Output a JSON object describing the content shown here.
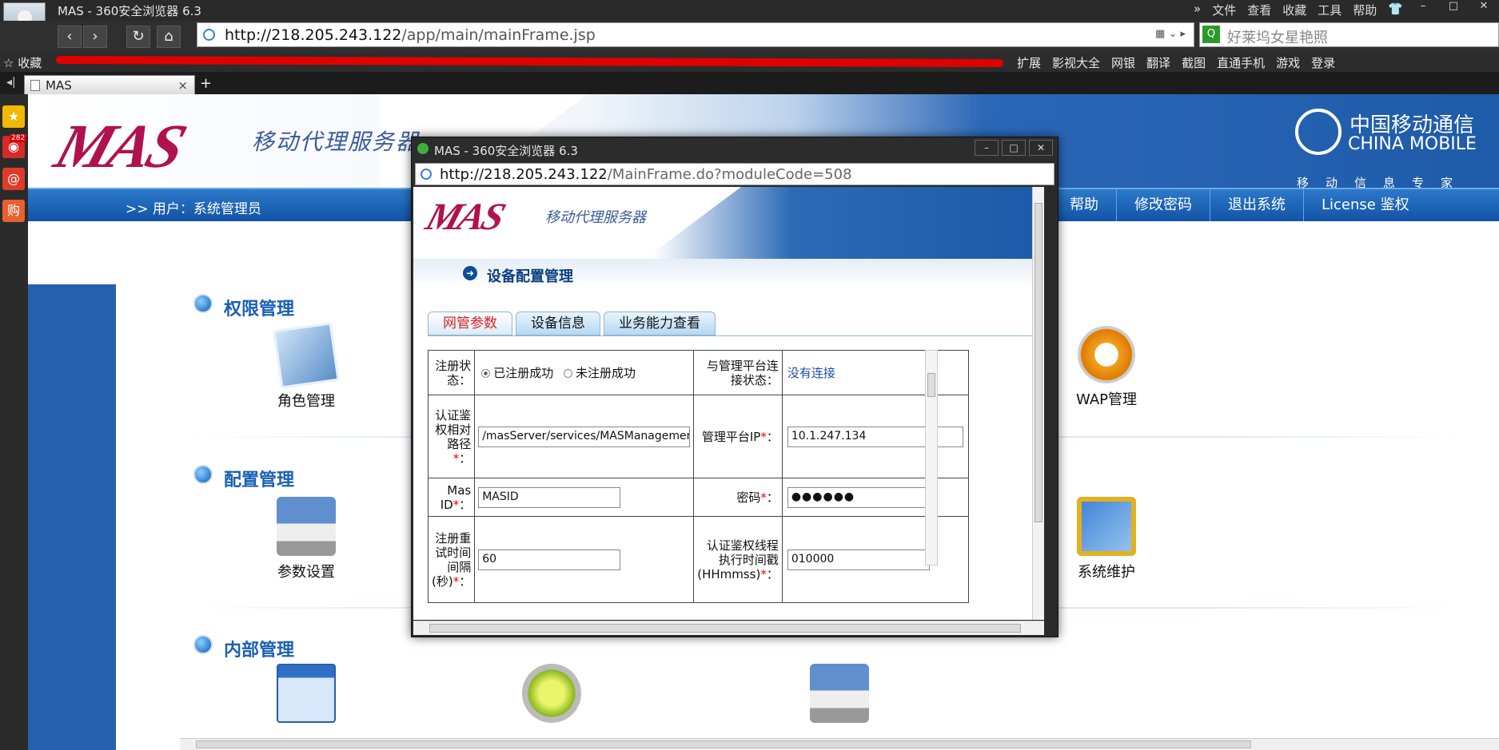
{
  "browser": {
    "window_title": "MAS - 360安全浏览器 6.3",
    "menu": [
      "文件",
      "查看",
      "收藏",
      "工具",
      "帮助"
    ],
    "url_host": "http://218.205.243.122",
    "url_path": "/app/main/mainFrame.jsp",
    "search_placeholder": "好莱坞女星艳照",
    "bookmarks_label": "收藏",
    "bookmarks_right": [
      "扩展",
      "影视大全",
      "网银",
      "翻译",
      "截图",
      "直通手机",
      "游戏",
      "登录"
    ],
    "tab_title": "MAS",
    "new_tab": "+",
    "sidebar_badge": "282"
  },
  "page": {
    "logo_text": "MAS",
    "logo_sub": "移动代理服务器",
    "china_mobile_zh": "中国移动通信",
    "china_mobile_en": "CHINA MOBILE",
    "china_mobile_tag": "移动信息专家",
    "user_line": ">> 用户：系统管理员",
    "menu": [
      "帮助",
      "修改密码",
      "退出系统",
      "License 鉴权"
    ],
    "sections": [
      {
        "title": "权限管理",
        "items": [
          "角色管理",
          "WAP管理"
        ]
      },
      {
        "title": "配置管理",
        "items": [
          "参数设置",
          "系统维护"
        ]
      },
      {
        "title": "内部管理",
        "items": []
      }
    ]
  },
  "popup": {
    "window_title": "MAS - 360安全浏览器 6.3",
    "url_host": "http://218.205.243.122",
    "url_path": "/MainFrame.do?moduleCode=508",
    "logo_text": "MAS",
    "logo_sub": "移动代理服务器",
    "heading": "设备配置管理",
    "tabs": [
      "网管参数",
      "设备信息",
      "业务能力查看"
    ],
    "form": {
      "reg_status_label": "注册状态：",
      "reg_opt_on": "已注册成功",
      "reg_opt_off": "未注册成功",
      "conn_label": "与管理平台连接状态：",
      "conn_value": "没有连接",
      "auth_path_label": "认证鉴权相对路径",
      "auth_path_value": "/masServer/services/MASManagementService",
      "mgmt_ip_label": "管理平台IP",
      "mgmt_ip_value": "10.1.247.134",
      "masid_label": "Mas ID",
      "masid_value": "MASID",
      "password_label": "密码",
      "password_value": "●●●●●●",
      "retry_label": "注册重试时间间隔(秒)",
      "retry_value": "60",
      "auth_time_label": "认证鉴权线程执行时间戳(HHmmss)",
      "auth_time_value": "010000",
      "required_mark": "*",
      "colon": "："
    }
  }
}
